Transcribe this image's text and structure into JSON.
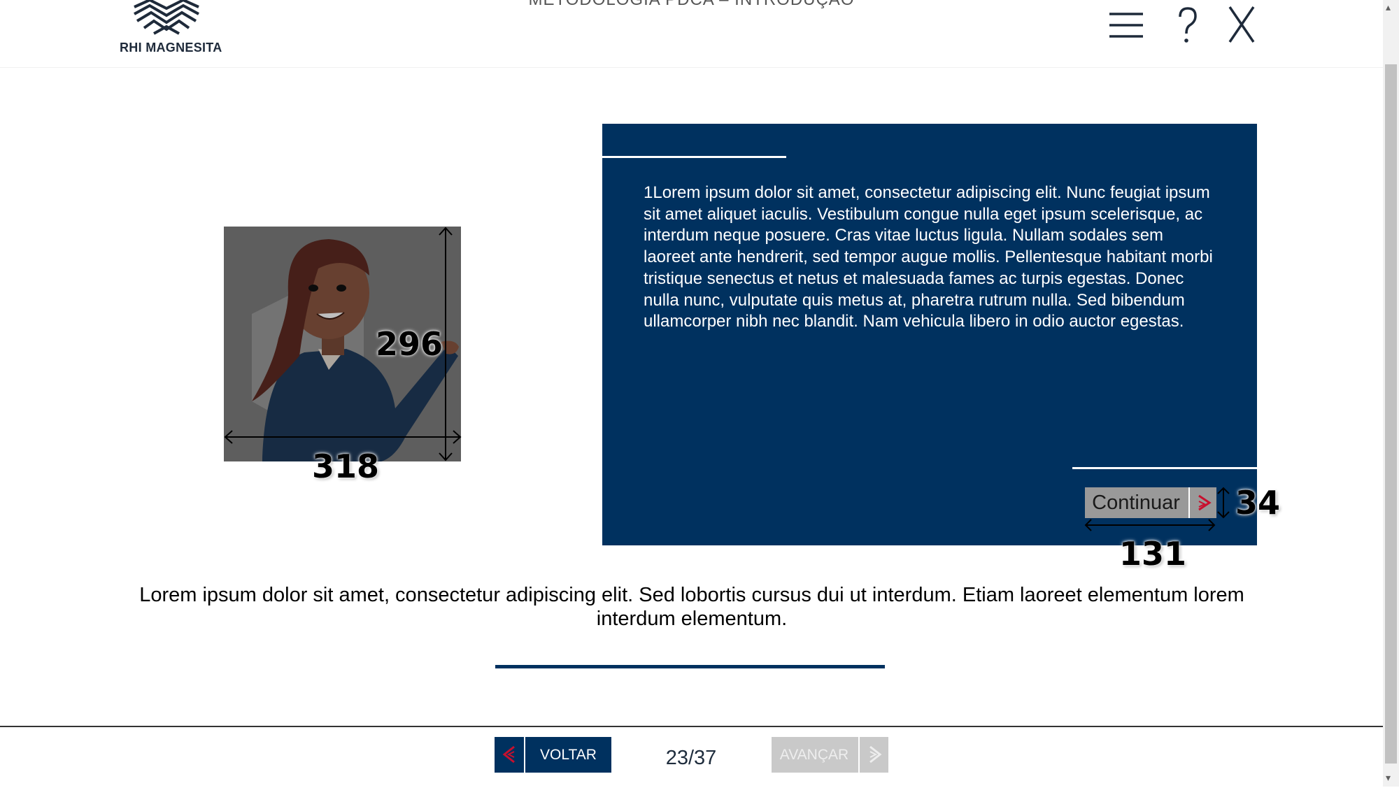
{
  "header": {
    "logo_text": "RHI MAGNESITA",
    "course_title": "METODOLOGIA PDCA – INTRODUÇÃO",
    "icons": [
      "menu-icon",
      "help-icon",
      "close-icon"
    ]
  },
  "card": {
    "text": "1Lorem ipsum dolor sit amet, consectetur adipiscing elit. Nunc feugiat ipsum sit amet aliquet iaculis. Vestibulum congue nulla eget ipsum scelerisque, ac interdum neque posuere. Cras vitae luctus ligula. Nullam sodales sem laoreet ante hendrerit, sed tempor augue mollis. Pellentesque habitant morbi tristique senectus et netus et malesuada fames ac turpis egestas. Donec nulla nunc, vulputate quis metus at, pharetra rutrum nulla. Sed bibendum ullamcorper nibh nec blandit. Nam vehicula libero in odio auctor egestas.",
    "continue_label": "Continuar",
    "background_color": "#00315f"
  },
  "body_text": "Lorem ipsum dolor sit amet, consectetur adipiscing elit. Sed lobortis cursus dui ut interdum. Etiam laoreet elementum lorem interdum elementum.",
  "annotations": {
    "image_width": "318",
    "image_height": "296",
    "button_width": "131",
    "button_height": "34"
  },
  "footer": {
    "back_label": "VOLTAR",
    "next_label": "AVANÇAR",
    "page_indicator": "23/37"
  },
  "colors": {
    "primary": "#00315f",
    "accent_arrow": "#c8102e",
    "disabled": "#c9c9c9"
  }
}
